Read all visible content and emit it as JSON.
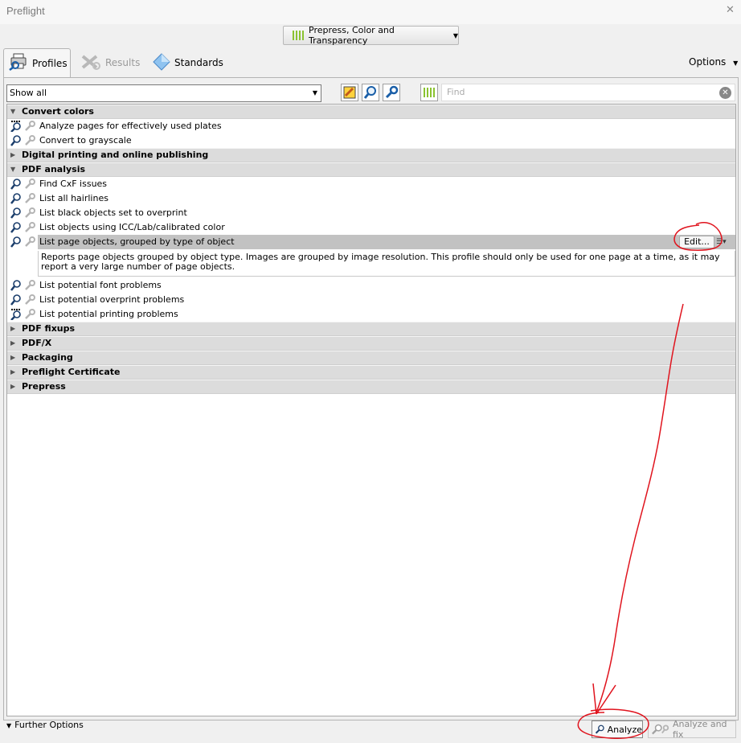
{
  "window": {
    "title": "Preflight"
  },
  "profile_switch": {
    "label": "Prepress, Color and Transparency"
  },
  "tabs": [
    {
      "label": "Profiles",
      "icon": "profiles-icon",
      "active": true
    },
    {
      "label": "Results",
      "icon": "results-icon",
      "active": false
    },
    {
      "label": "Standards",
      "icon": "standards-icon",
      "active": false
    }
  ],
  "options_label": "Options",
  "filter": {
    "selected": "Show all"
  },
  "search": {
    "placeholder": "Find"
  },
  "groups": [
    {
      "label": "Convert colors",
      "expanded": true,
      "items": [
        {
          "label": "Analyze pages for effectively used plates"
        },
        {
          "label": "Convert to grayscale"
        }
      ]
    },
    {
      "label": "Digital printing and online publishing",
      "expanded": false
    },
    {
      "label": "PDF analysis",
      "expanded": true,
      "items": [
        {
          "label": "Find CxF issues"
        },
        {
          "label": "List all hairlines"
        },
        {
          "label": "List black objects set to overprint"
        },
        {
          "label": "List objects using ICC/Lab/calibrated color"
        },
        {
          "label": "List page objects, grouped by type of object",
          "selected": true,
          "edit_label": "Edit...",
          "description": "Reports page objects grouped by object type. Images are grouped by image resolution. This profile should only be used for one page at a time, as it may report a very large number of page objects."
        },
        {
          "label": "List potential font problems"
        },
        {
          "label": "List potential overprint problems"
        },
        {
          "label": "List potential printing problems"
        }
      ]
    },
    {
      "label": "PDF fixups",
      "expanded": false
    },
    {
      "label": "PDF/X",
      "expanded": false
    },
    {
      "label": "Packaging",
      "expanded": false
    },
    {
      "label": "Preflight Certificate",
      "expanded": false
    },
    {
      "label": "Prepress",
      "expanded": false
    }
  ],
  "footer": {
    "further_options": "Further Options",
    "analyze": "Analyze",
    "analyze_fix": "Analyze and fix"
  },
  "colors": {
    "accent_green": "#8ac230",
    "annotation_red": "#e0141e",
    "selected_row": "#c2c2c2",
    "group_row": "#dcdcdc"
  }
}
